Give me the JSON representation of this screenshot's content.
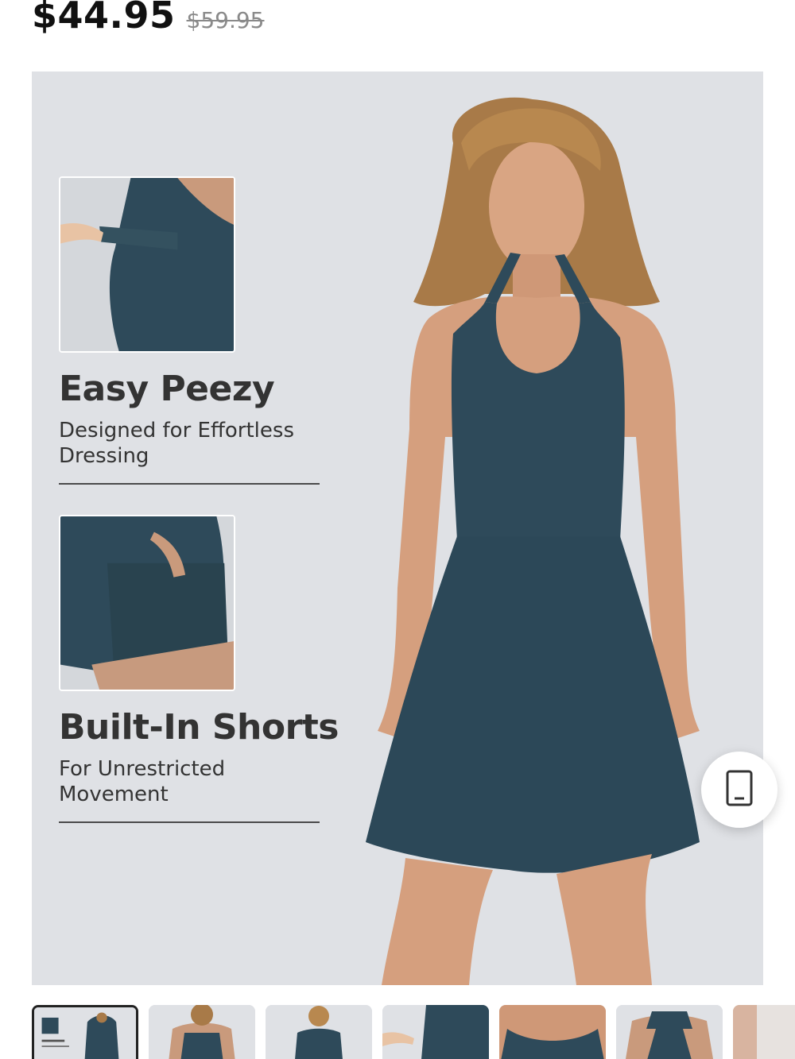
{
  "pricing": {
    "current_price": "$44.95",
    "original_price": "$59.95"
  },
  "features": [
    {
      "title": "Easy Peezy",
      "subtitle": "Designed for Effortless Dressing"
    },
    {
      "title": "Built-In Shorts",
      "subtitle": "For Unrestricted Movement"
    }
  ],
  "floating_button": {
    "icon": "phone-icon"
  },
  "thumbnails": [
    {
      "icon": "thumbnail-1",
      "selected": true
    },
    {
      "icon": "thumbnail-2",
      "selected": false
    },
    {
      "icon": "thumbnail-3",
      "selected": false
    },
    {
      "icon": "thumbnail-4",
      "selected": false
    },
    {
      "icon": "thumbnail-5",
      "selected": false
    },
    {
      "icon": "thumbnail-6",
      "selected": false
    },
    {
      "icon": "thumbnail-7",
      "selected": false
    }
  ],
  "colors": {
    "dress": "#2e4a5a",
    "background": "#dfe1e5"
  }
}
